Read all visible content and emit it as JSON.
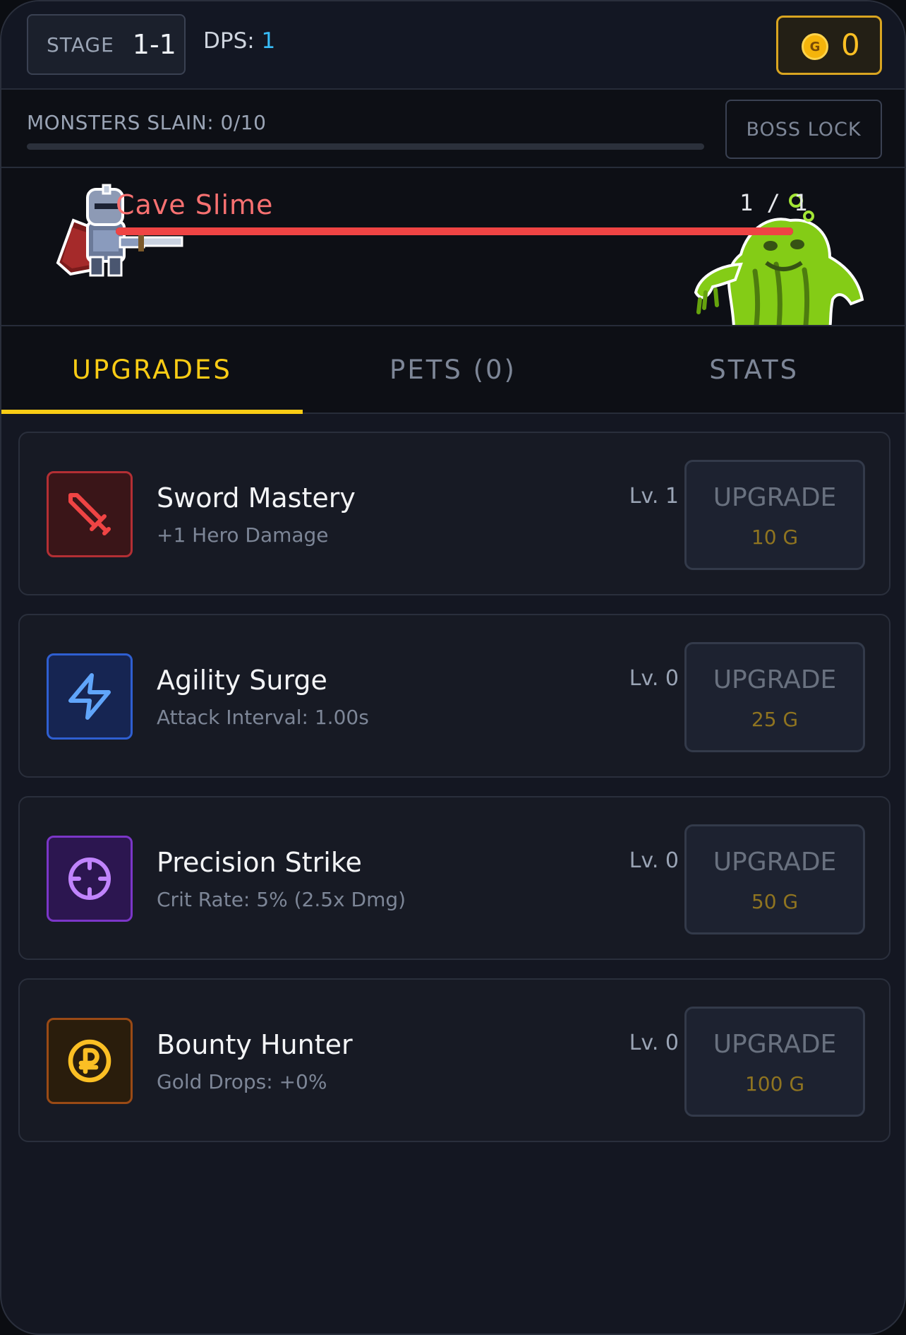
{
  "header": {
    "stage_label": "STAGE",
    "stage_value": "1-1",
    "dps_label": "DPS:",
    "dps_value": "1",
    "gold_icon_letter": "G",
    "gold_amount": "0"
  },
  "progress": {
    "slain_text": "MONSTERS SLAIN: 0/10",
    "slain_fraction": 0.0,
    "boss_lock_label": "BOSS LOCK"
  },
  "battle": {
    "hero_icon": "armored-knight-sprite",
    "monster_icon": "green-slime-monster-sprite",
    "enemy_name": "Cave Slime",
    "hp_text": "1 / 1",
    "hp_fraction": 1.0
  },
  "tabs": [
    {
      "label": "UPGRADES",
      "active": true
    },
    {
      "label": "PETS (0)",
      "active": false
    },
    {
      "label": "STATS",
      "active": false
    }
  ],
  "upgrades": [
    {
      "title": "Sword Mastery",
      "desc": "+1 Hero Damage",
      "level": "Lv. 1",
      "button_label": "UPGRADE",
      "cost": "10 G",
      "icon": "sword-icon",
      "color": "#ef4444",
      "bg": "#3a1518",
      "border": "#b32f34"
    },
    {
      "title": "Agility Surge",
      "desc": "Attack Interval: 1.00s",
      "level": "Lv. 0",
      "button_label": "UPGRADE",
      "cost": "25 G",
      "icon": "lightning-icon",
      "color": "#60a5fa",
      "bg": "#162552",
      "border": "#2f5fd1"
    },
    {
      "title": "Precision Strike",
      "desc": "Crit Rate: 5% (2.5x Dmg)",
      "level": "Lv. 0",
      "button_label": "UPGRADE",
      "cost": "50 G",
      "icon": "crosshair-icon",
      "color": "#c084fc",
      "bg": "#2c1650",
      "border": "#7b36c8"
    },
    {
      "title": "Bounty Hunter",
      "desc": "Gold Drops: +0%",
      "level": "Lv. 0",
      "button_label": "UPGRADE",
      "cost": "100 G",
      "icon": "coin-icon",
      "color": "#fbbf24",
      "bg": "#2a1d0c",
      "border": "#9a4a15"
    }
  ]
}
